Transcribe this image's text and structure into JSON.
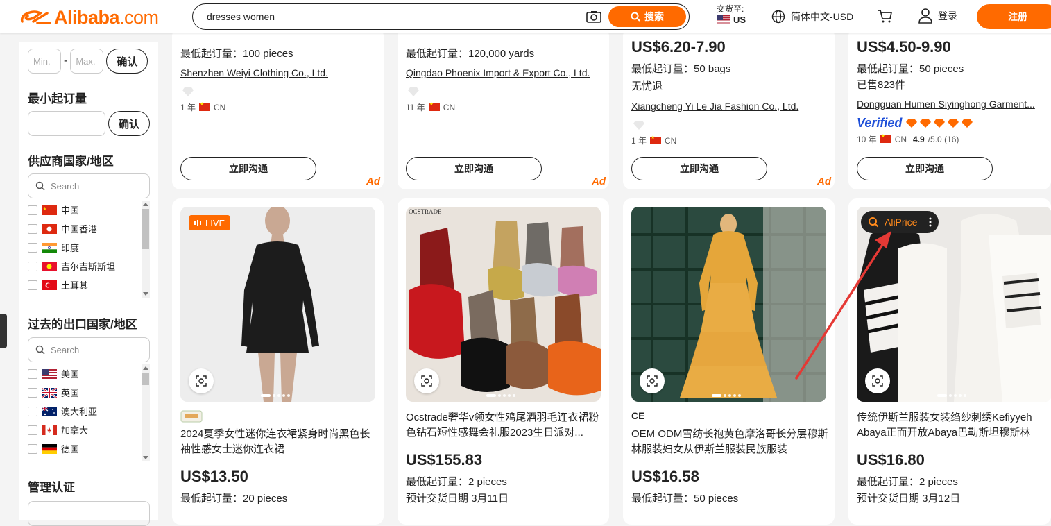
{
  "header": {
    "logo_text": "Alibaba",
    "logo_suffix": ".com",
    "search_value": "dresses women",
    "search_button": "搜索",
    "deliver_label": "交货至:",
    "deliver_country": "US",
    "language": "简体中文-USD",
    "login": "登录",
    "register": "注册"
  },
  "sidebar": {
    "price_min_placeholder": "Min.",
    "price_max_placeholder": "Max.",
    "price_dash": "-",
    "confirm": "确认",
    "moq_title": "最小起订量",
    "moq_confirm": "确认",
    "supplier_region_title": "供应商国家/地区",
    "search_placeholder": "Search",
    "supplier_countries": [
      "中国",
      "中国香港",
      "印度",
      "吉尔吉斯斯坦",
      "土耳其"
    ],
    "export_title": "过去的出口国家/地区",
    "export_search_placeholder": "Search",
    "export_countries": [
      "美国",
      "英国",
      "澳大利亚",
      "加拿大",
      "德国"
    ],
    "cert_title": "管理认证"
  },
  "top_cards": [
    {
      "moq": "最低起订量：100 pieces",
      "supplier": "Shenzhen Weiyi Clothing Co., Ltd.",
      "years": "1 年",
      "country": "CN",
      "chat": "立即沟通",
      "ad": "Ad"
    },
    {
      "moq": "最低起订量：120,000 yards",
      "supplier": "Qingdao Phoenix Import & Export Co., Ltd.",
      "years": "11 年",
      "country": "CN",
      "chat": "立即沟通",
      "ad": "Ad"
    },
    {
      "price": "US$6.20-7.90",
      "moq": "最低起订量：50 bags",
      "extra": "无忧退",
      "supplier": "Xiangcheng Yi Le Jia Fashion Co., Ltd.",
      "years": "1 年",
      "country": "CN",
      "chat": "立即沟通",
      "ad": "Ad"
    },
    {
      "price": "US$4.50-9.90",
      "moq": "最低起订量：50 pieces",
      "extra": "已售823件",
      "supplier": "Dongguan Humen Siyinghong Garment...",
      "verified": "Verified",
      "years": "10 年",
      "country": "CN",
      "rating": "4.9",
      "rating_suffix": "/5.0 (16)",
      "chat": "立即沟通"
    }
  ],
  "products": [
    {
      "live": "LIVE",
      "title": "2024夏季女性迷你连衣裙紧身时尚黑色长袖性感女士迷你连衣裙",
      "price": "US$13.50",
      "moq": "最低起订量：20 pieces"
    },
    {
      "watermark": "OCSTRADE",
      "title": "Ocstrade奢华v领女性鸡尾酒羽毛连衣裙粉色钻石短性感舞会礼服2023生日派对...",
      "price": "US$155.83",
      "moq": "最低起订量：2 pieces",
      "delivery": "预计交货日期 3月11日"
    },
    {
      "badge": "CE",
      "title": "OEM ODM雪纺长袍黄色摩洛哥长分层穆斯林服装妇女从伊斯兰服装民族服装",
      "price": "US$16.58",
      "moq": "最低起订量：50 pieces"
    },
    {
      "aliprice": "AliPrice",
      "title": "传统伊斯兰服装女装绉纱刺绣Kefiyyeh Abaya正面开放Abaya巴勒斯坦穆斯林民...",
      "price": "US$16.80",
      "moq": "最低起订量：2 pieces",
      "delivery": "预计交货日期 3月12日"
    }
  ],
  "colors": {
    "accent": "#ff6a00",
    "text": "#222222",
    "background": "#f4f4f4"
  }
}
